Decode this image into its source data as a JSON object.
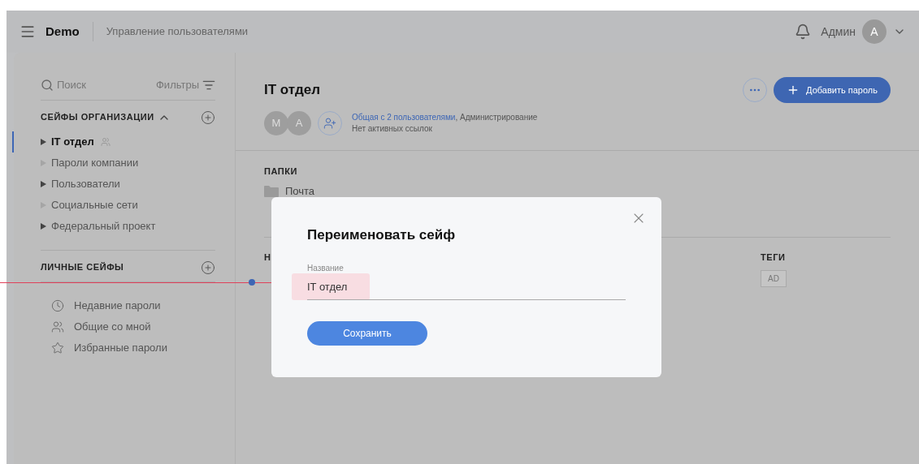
{
  "header": {
    "brand": "Demo",
    "section": "Управление пользователями",
    "user": "Админ",
    "avatar": "A"
  },
  "sidebar": {
    "search": {
      "placeholder": "Поиск"
    },
    "filters": "Фильтры",
    "org_title": "СЕЙФЫ ОРГАНИЗАЦИИ",
    "org_items": [
      {
        "label": "IT отдел",
        "selected": true,
        "expandable": true,
        "shared": true
      },
      {
        "label": "Пароли компании",
        "selected": false,
        "expandable": false,
        "shared": false
      },
      {
        "label": "Пользователи",
        "selected": false,
        "expandable": true,
        "shared": false
      },
      {
        "label": "Социальные сети",
        "selected": false,
        "expandable": false,
        "shared": false
      },
      {
        "label": "Федеральный проект",
        "selected": false,
        "expandable": true,
        "shared": false
      }
    ],
    "personal_title": "ЛИЧНЫЕ СЕЙФЫ",
    "links": [
      {
        "kind": "clock",
        "label": "Недавние пароли"
      },
      {
        "kind": "users",
        "label": "Общие со мной"
      },
      {
        "kind": "star",
        "label": "Избранные пароли"
      }
    ]
  },
  "main": {
    "title": "IT отдел",
    "members": [
      "M",
      "A"
    ],
    "shared_link": "Общая с 2 пользователями",
    "shared_rest": ", Администрирование",
    "links_note": "Нет активных ссылок",
    "add_button": "Добавить пароль",
    "folders_title": "ПАПКИ",
    "folders": [
      "Почта"
    ],
    "column_1": "Н",
    "tags_title": "ТЕГИ",
    "tag": "AD"
  },
  "dialog": {
    "title": "Переименовать сейф",
    "field_label": "Название",
    "field_value": "IT отдел",
    "save": "Сохранить"
  }
}
